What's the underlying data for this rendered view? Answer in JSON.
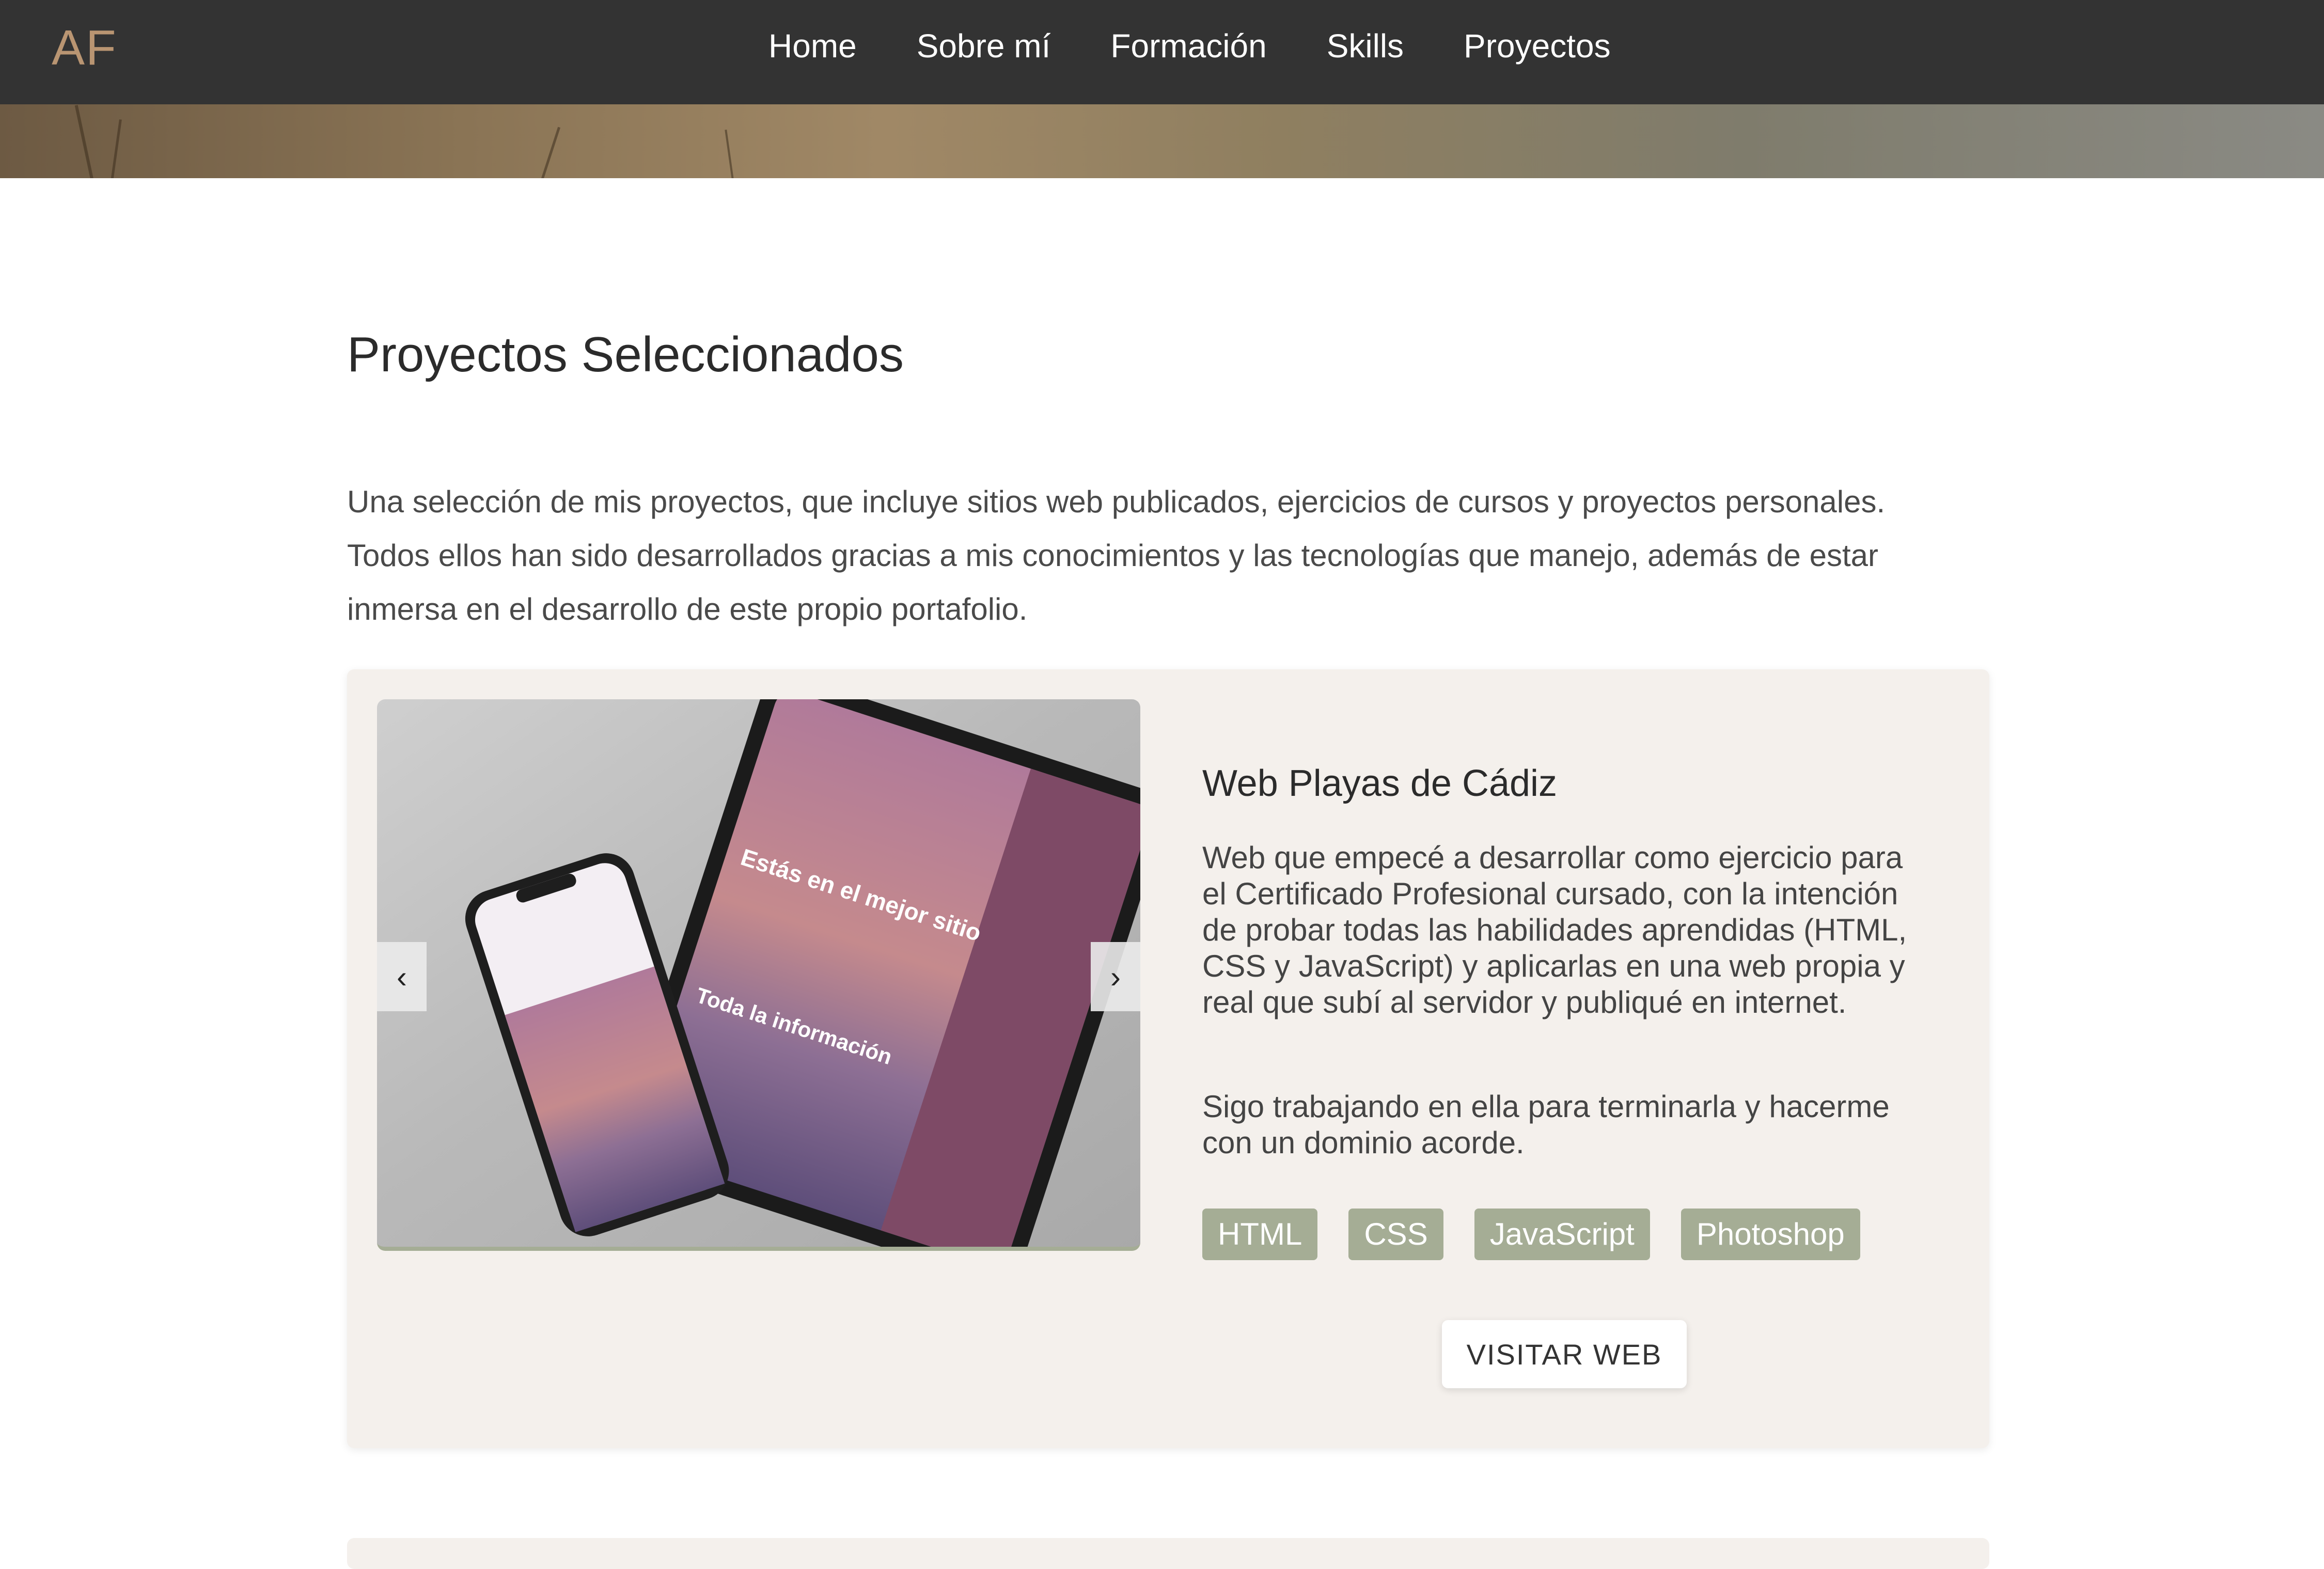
{
  "brand": {
    "logo_text": "AF"
  },
  "nav": {
    "items": [
      {
        "label": "Home"
      },
      {
        "label": "Sobre mí"
      },
      {
        "label": "Formación"
      },
      {
        "label": "Skills"
      },
      {
        "label": "Proyectos"
      }
    ]
  },
  "main": {
    "title": "Proyectos Seleccionados",
    "intro": "Una selección de mis proyectos, que incluye sitios web publicados, ejercicios de cursos y proyectos personales. Todos ellos han sido desarrollados gracias a mis conocimientos y las tecnologías que manejo, además de estar inmersa en el desarrollo de este propio portafolio."
  },
  "project": {
    "title": "Web Playas de Cádiz",
    "description": "Web que empecé a desarrollar como ejercicio para el Certificado Profesional cursado, con la intención de probar todas las habilidades aprendidas (HTML, CSS y JavaScript) y aplicarlas en una web propia y real que subí al servidor y publiqué en internet.",
    "description2": "Sigo trabajando en ella para terminarla y hacerme con un dominio acorde.",
    "tags": [
      "HTML",
      "CSS",
      "JavaScript",
      "Photoshop"
    ],
    "visit_label": "VISITAR WEB",
    "carousel": {
      "prev_label": "‹",
      "next_label": "›",
      "mockup_text": {
        "tablet_headline": "Estás en el mejor sitio para saber todo sobre las fabulosas playas que tenemos en la provincia de Cádiz.",
        "tablet_sub": "Toda la información que necesitas para disfrutarlas al máximo."
      }
    }
  },
  "colors": {
    "nav_bg": "#333333",
    "logo": "#b99572",
    "card_bg": "#f4f0ec",
    "tag_bg": "#a5ad95",
    "mockup_purple": "#7e4a66"
  }
}
